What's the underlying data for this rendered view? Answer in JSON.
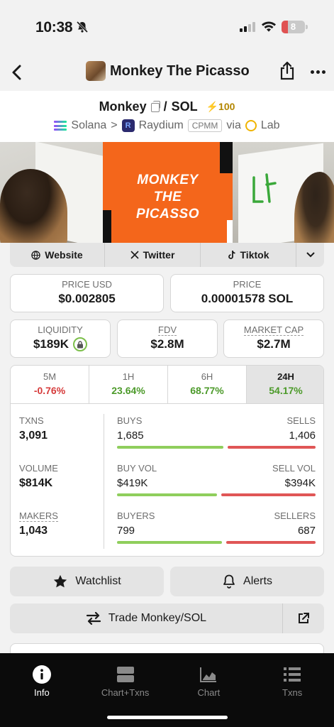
{
  "status_bar": {
    "time": "10:38",
    "battery": "8"
  },
  "nav": {
    "title": "Monkey The Picasso"
  },
  "pair": {
    "base": "Monkey",
    "separator": "/",
    "quote": "SOL",
    "boost": "⚡100",
    "chain": "Solana",
    "chevron": ">",
    "dex": "Raydium",
    "pool_type": "CPMM",
    "via": "via",
    "launchpad": "Lab"
  },
  "banner": {
    "line1": "MONKEY",
    "line2": "THE",
    "line3": "PICASSO"
  },
  "social": {
    "website": "Website",
    "twitter": "Twitter",
    "tiktok": "Tiktok"
  },
  "prices": {
    "usd_label": "PRICE USD",
    "usd_value": "$0.002805",
    "native_label": "PRICE",
    "native_value": "0.00001578 SOL"
  },
  "metrics": {
    "liquidity_label": "LIQUIDITY",
    "liquidity_value": "$189K",
    "fdv_label": "FDV",
    "fdv_value": "$2.8M",
    "mcap_label": "MARKET CAP",
    "mcap_value": "$2.7M"
  },
  "timeframes": [
    {
      "period": "5M",
      "change": "-0.76%"
    },
    {
      "period": "1H",
      "change": "23.64%"
    },
    {
      "period": "6H",
      "change": "68.77%"
    },
    {
      "period": "24H",
      "change": "54.17%"
    }
  ],
  "stats": {
    "txns_label": "TXNS",
    "txns": "3,091",
    "volume_label": "VOLUME",
    "volume": "$814K",
    "makers_label": "MAKERS",
    "makers": "1,043",
    "buys_label": "BUYS",
    "buys": "1,685",
    "sells_label": "SELLS",
    "sells": "1,406",
    "buy_vol_label": "BUY VOL",
    "buy_vol": "$419K",
    "sell_vol_label": "SELL VOL",
    "sell_vol": "$394K",
    "buyers_label": "BUYERS",
    "buyers": "799",
    "sellers_label": "SELLERS",
    "sellers": "687",
    "buys_fraction": 0.545,
    "buy_vol_fraction": 0.515,
    "buyers_fraction": 0.538
  },
  "actions": {
    "watchlist": "Watchlist",
    "alerts": "Alerts",
    "trade": "Trade Monkey/SOL"
  },
  "tabbar": [
    {
      "label": "Info",
      "icon": "info-icon",
      "active": true
    },
    {
      "label": "Chart+Txns",
      "icon": "chart-txns-icon",
      "active": false
    },
    {
      "label": "Chart",
      "icon": "chart-icon",
      "active": false
    },
    {
      "label": "Txns",
      "icon": "list-icon",
      "active": false
    }
  ],
  "colors": {
    "positive": "#4c9a2a",
    "negative": "#d63b3b",
    "boost": "#b38600",
    "buy_bar": "#8fce5c",
    "sell_bar": "#e05656"
  }
}
